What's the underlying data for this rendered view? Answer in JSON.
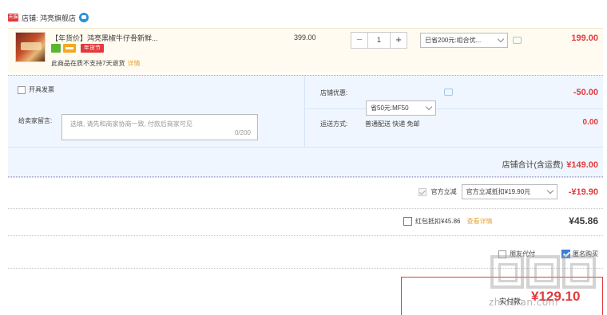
{
  "shop": {
    "icon": "tmall-shop-icon",
    "label": "店铺: 鸿亮旗舰店",
    "chat_icon": "wangwang-chat-icon"
  },
  "item": {
    "title": "【年货价】鸿亮黑椒牛仔骨新鲜...",
    "badge_festival": "年货节",
    "notice": "此商品在质不支持7天退货",
    "notice_link": "详情",
    "unit_price": "399.00",
    "quantity": "1",
    "minus": "−",
    "plus": "+",
    "promo_select": "已省200元:组合优...",
    "subtotal": "199.00"
  },
  "options": {
    "invoice_label": "开具发票",
    "remark_label": "给卖家留言:",
    "remark_placeholder": "选填, 请先和商家协商一致, 付款后商家可见",
    "remark_counter": "0/200",
    "shop_discount_label": "店铺优惠:",
    "shop_discount_select": "省50元:MF50",
    "shop_discount_amount": "-50.00",
    "shipping_label": "运送方式:",
    "shipping_value": "普通配送 快递 免邮",
    "shipping_price": "0.00"
  },
  "shop_total": {
    "label": "店铺合计(含运费)",
    "amount": "¥149.00"
  },
  "tmall_discount": {
    "label": "官方立减",
    "select": "官方立减抵扣¥19.90元",
    "amount": "-¥19.90"
  },
  "red_packet": {
    "label": "红包抵扣¥45.86",
    "link": "查看详情",
    "amount": "¥45.86"
  },
  "footer": {
    "agent_label": "朋友代付",
    "anon_label": "匿名购买",
    "pay_label": "实付款:",
    "pay_amount": "¥129.10"
  },
  "watermark": {
    "text": "zhidefan.com"
  },
  "colors": {
    "price_red": "#e4393c",
    "link_orange": "#e4a53c",
    "panel_blue": "#f0f6ff",
    "item_bg": "#fffbf0",
    "check_blue": "#3a7fd5"
  }
}
